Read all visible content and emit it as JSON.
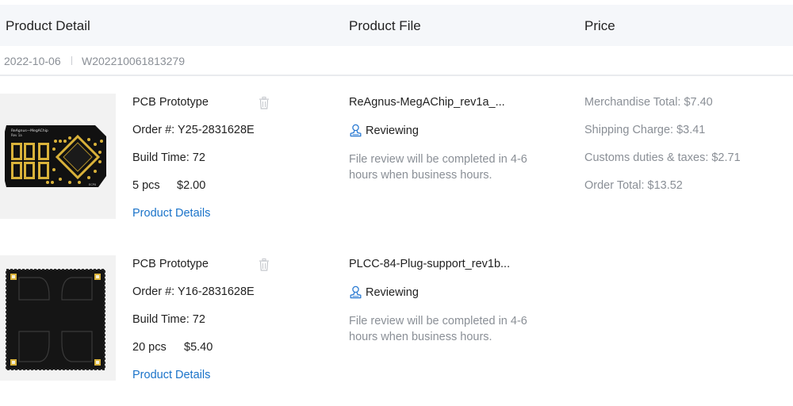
{
  "header": {
    "product_detail": "Product Detail",
    "product_file": "Product File",
    "price": "Price"
  },
  "order": {
    "date": "2022-10-06",
    "number": "W202210061813279"
  },
  "items": [
    {
      "title": "PCB Prototype",
      "order_number": "Order #: Y25-2831628E",
      "build_time": "Build Time: 72",
      "quantity": "5 pcs",
      "price": "$2.00",
      "details_link": "Product Details",
      "file_name": "ReAgnus-MegAChip_rev1a_...",
      "status": "Reviewing",
      "note": "File review will be completed in 4-6 hours when business hours.",
      "thumb_icon": "pcb-board-image"
    },
    {
      "title": "PCB Prototype",
      "order_number": "Order #: Y16-2831628E",
      "build_time": "Build Time: 72",
      "quantity": "20 pcs",
      "price": "$5.40",
      "details_link": "Product Details",
      "file_name": "PLCC-84-Plug-support_rev1b...",
      "status": "Reviewing",
      "note": "File review will be completed in 4-6 hours when business hours.",
      "thumb_icon": "pcb-board-image"
    }
  ],
  "price_summary": {
    "merchandise_total": "Merchandise Total: $7.40",
    "shipping_charge": "Shipping Charge: $3.41",
    "customs": "Customs duties & taxes: $2.71",
    "order_total": "Order Total: $13.52"
  },
  "colors": {
    "header_bg": "#f5f7fa",
    "link": "#1a73c9",
    "muted_text": "#8a8f96",
    "status_icon": "#2a7ad2",
    "pcb_black": "#111111",
    "pcb_gold": "#d9b23a"
  }
}
